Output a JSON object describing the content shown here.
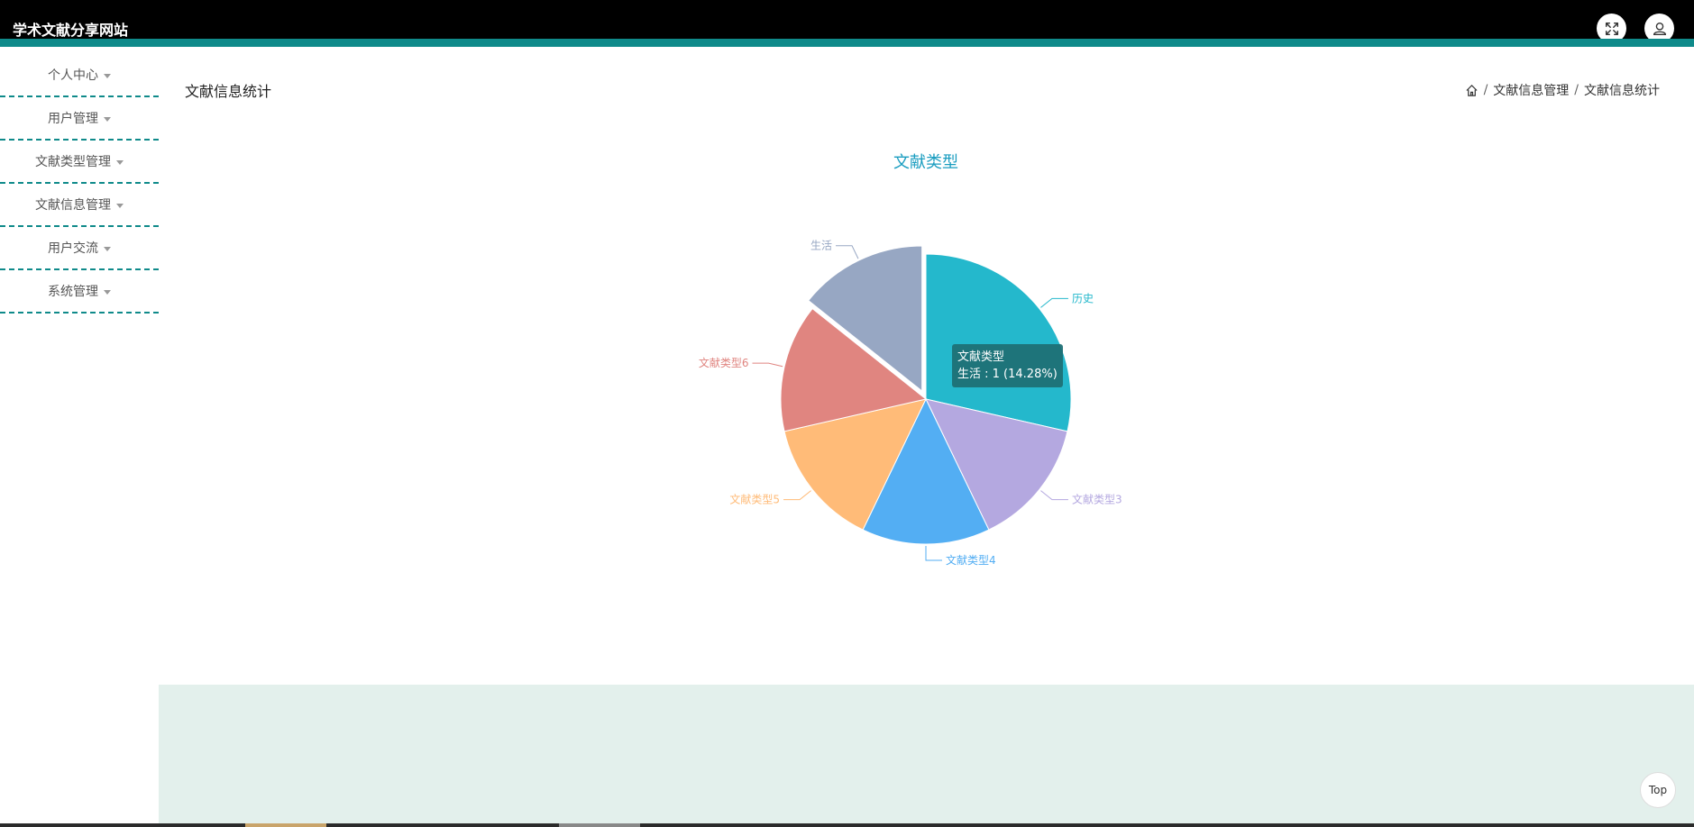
{
  "app": {
    "title": "学术文献分享网站"
  },
  "header": {
    "icons": [
      "fullscreen-icon",
      "user-icon"
    ]
  },
  "sidebar": {
    "items": [
      {
        "label": "个人中心"
      },
      {
        "label": "用户管理"
      },
      {
        "label": "文献类型管理"
      },
      {
        "label": "文献信息管理"
      },
      {
        "label": "用户交流"
      },
      {
        "label": "系统管理"
      }
    ]
  },
  "page": {
    "title": "文献信息统计",
    "breadcrumb": [
      "文献信息管理",
      "文献信息统计"
    ]
  },
  "chart_data": {
    "type": "pie",
    "title": "文献类型",
    "categories": [
      "历史",
      "文献类型3",
      "文献类型4",
      "文献类型5",
      "文献类型6",
      "生活"
    ],
    "values": [
      2,
      1,
      1,
      1,
      1,
      1
    ],
    "colors": [
      "#24b8cc",
      "#b4a8e0",
      "#53aef3",
      "#ffbb78",
      "#e08580",
      "#97a7c3"
    ],
    "highlighted": "生活",
    "title_color": "#1a9dc0"
  },
  "tooltip": {
    "title": "文献类型",
    "text": "生活 : 1 (14.28%)"
  },
  "back_to_top": {
    "label": "Top"
  },
  "colors": {
    "accent": "#0f8a8a",
    "header_bg": "#000000",
    "footer_bg": "#e3f0ec"
  }
}
